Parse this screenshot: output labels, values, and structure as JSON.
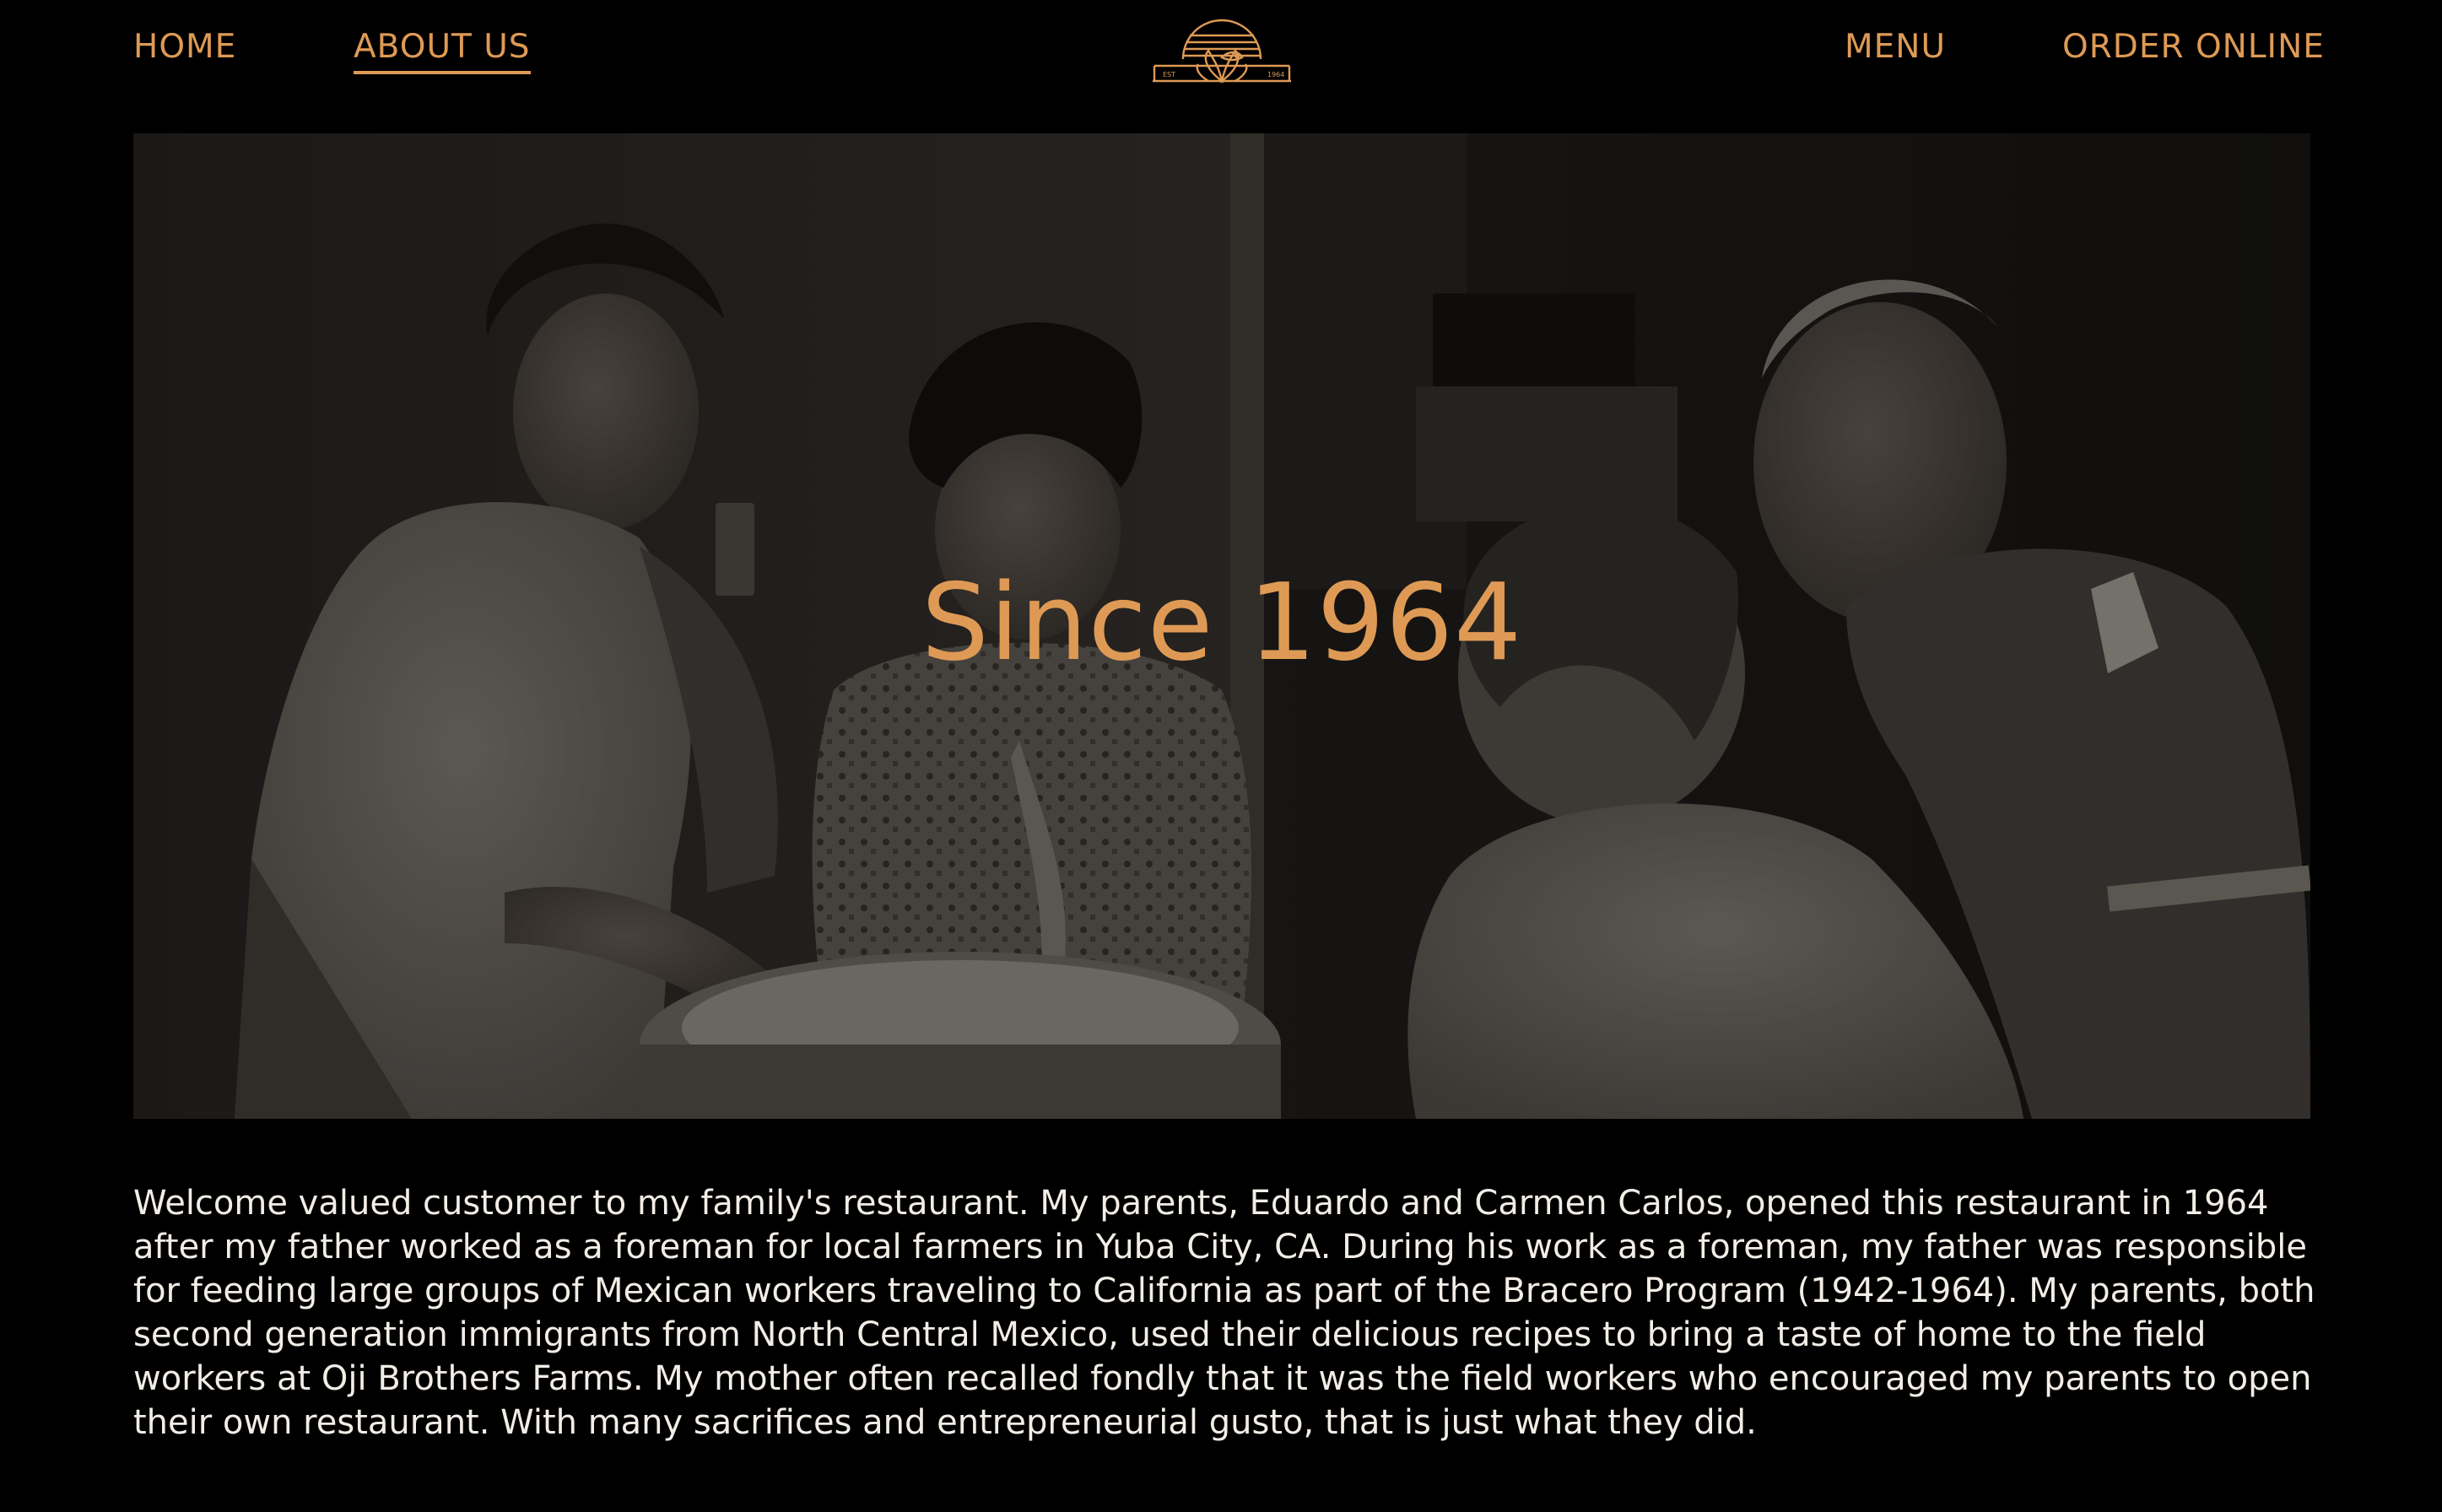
{
  "nav": {
    "left_links": [
      {
        "label": "HOME",
        "active": false
      },
      {
        "label": "ABOUT US",
        "active": true
      }
    ],
    "right_links": [
      {
        "label": "MENU",
        "active": false
      },
      {
        "label": "ORDER ONLINE",
        "active": false
      }
    ],
    "logo": {
      "icon": "restaurant-sunburst-logo",
      "text_left": "EST",
      "text_right": "1964"
    }
  },
  "hero": {
    "title": "Since 1964",
    "image": "vintage-family-kitchen-photo"
  },
  "story": {
    "paragraph": "Welcome valued customer to my family's restaurant. My parents, Eduardo and Carmen Carlos, opened this restaurant in 1964 after my father worked as a foreman for local farmers in Yuba City, CA. During his work as a foreman, my father was responsible for feeding large groups of Mexican workers traveling to California as part of the Bracero Program (1942-1964). My parents, both second generation immigrants from North Central Mexico, used their delicious recipes to bring a taste of home to the field workers at Oji Brothers Farms. My mother often recalled fondly that it was the field workers who encouraged my parents to open their own restaurant. With many sacrifices and entrepreneurial gusto, that is just what they did."
  },
  "colors": {
    "background": "#000000",
    "accent": "#de9a55",
    "text": "#f2ede6"
  }
}
